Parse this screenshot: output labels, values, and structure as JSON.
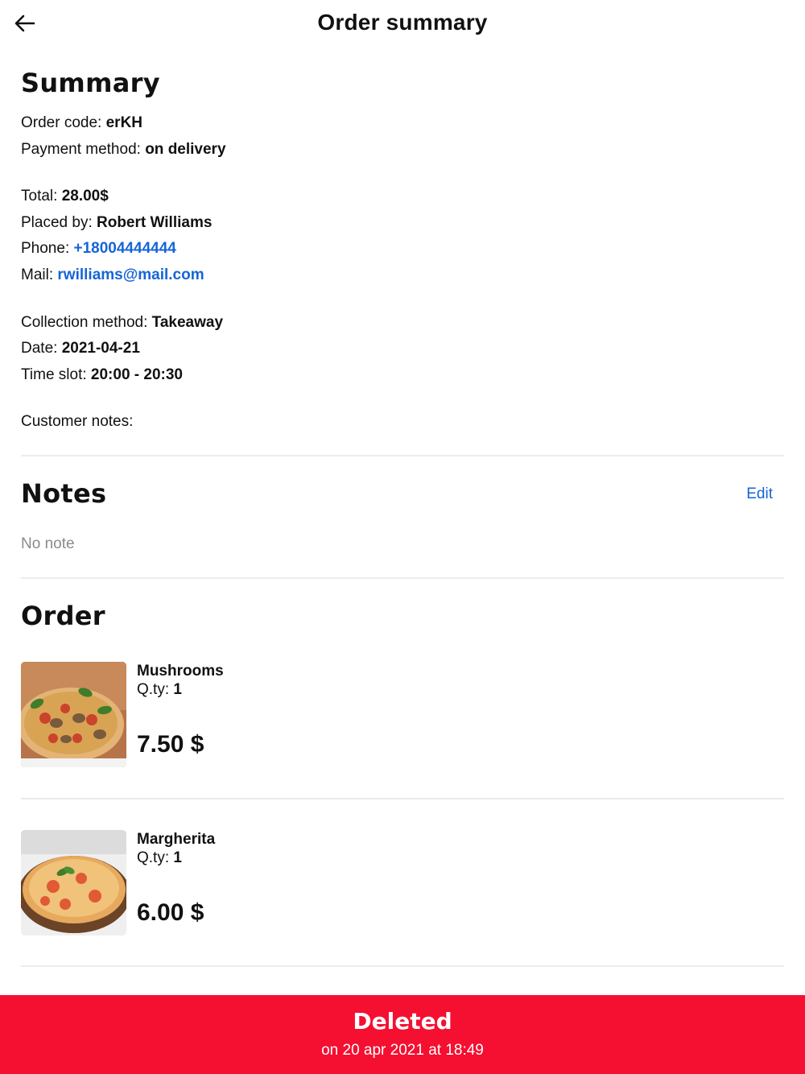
{
  "header": {
    "title": "Order summary",
    "back_icon": "arrow-left-icon"
  },
  "summary": {
    "title": "Summary",
    "order_code_label": "Order code: ",
    "order_code": "erKH",
    "payment_label": "Payment method: ",
    "payment": "on delivery",
    "total_label": "Total: ",
    "total": "28.00$",
    "placed_by_label": "Placed by: ",
    "placed_by": "Robert Williams",
    "phone_label": "Phone: ",
    "phone": "+18004444444",
    "mail_label": "Mail: ",
    "mail": "rwilliams@mail.com",
    "collection_label": "Collection method: ",
    "collection": "Takeaway",
    "date_label": "Date: ",
    "date": "2021-04-21",
    "timeslot_label": "Time slot: ",
    "timeslot": "20:00 - 20:30",
    "customer_notes_label": "Customer notes:"
  },
  "notes": {
    "title": "Notes",
    "edit_label": "Edit",
    "empty_text": "No note"
  },
  "order": {
    "title": "Order",
    "items": [
      {
        "name": "Mushrooms",
        "qty_label": "Q.ty: ",
        "qty": "1",
        "price": "7.50 $"
      },
      {
        "name": "Margherita",
        "qty_label": "Q.ty: ",
        "qty": "1",
        "price": "6.00 $"
      }
    ]
  },
  "footer": {
    "status": "Deleted",
    "date": "on 20 apr 2021 at 18:49",
    "color": "#f50f31"
  },
  "colors": {
    "link": "#1565d8",
    "muted": "#8a8a8a",
    "divider": "#ececec"
  }
}
